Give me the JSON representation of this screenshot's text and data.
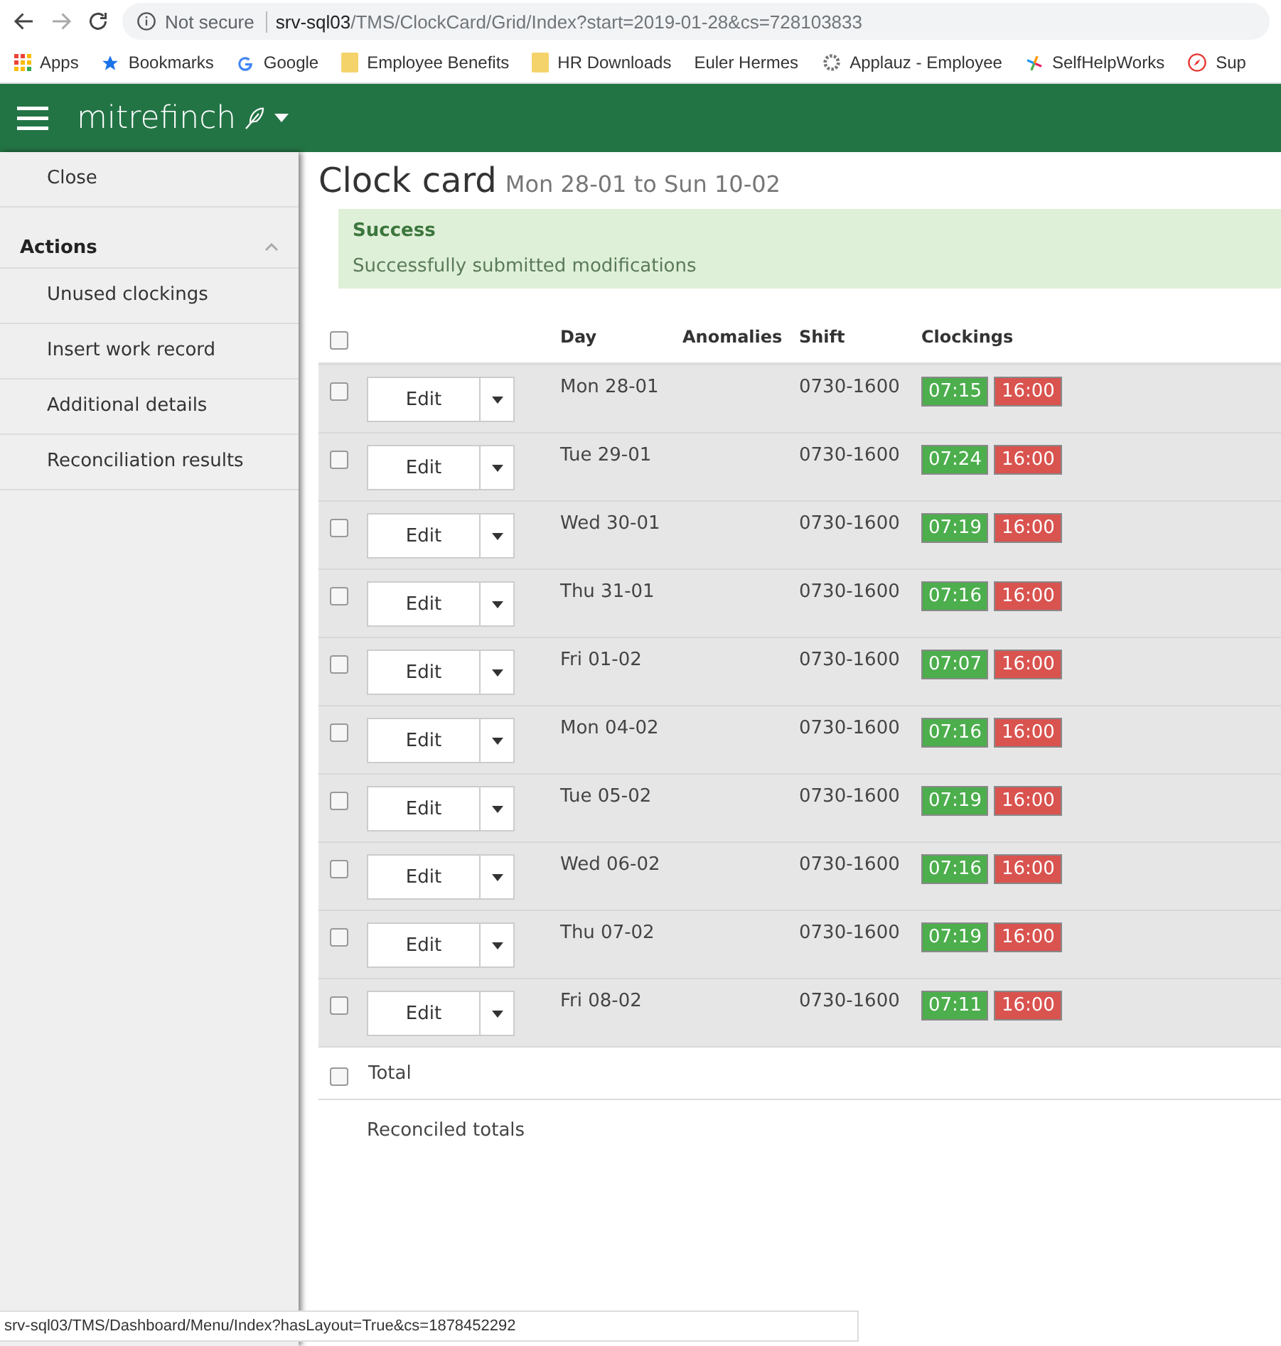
{
  "browser": {
    "security": "Not secure",
    "url_host": "srv-sql03",
    "url_path": "/TMS/ClockCard/Grid/Index?start=2019-01-28&cs=728103833",
    "bookmarks": [
      {
        "label": "Apps",
        "kind": "grid"
      },
      {
        "label": "Bookmarks",
        "kind": "star"
      },
      {
        "label": "Google",
        "kind": "google"
      },
      {
        "label": "Employee Benefits",
        "kind": "folder"
      },
      {
        "label": "HR Downloads",
        "kind": "folder"
      },
      {
        "label": "Euler Hermes",
        "kind": "plain"
      },
      {
        "label": "Applauz - Employee",
        "kind": "gear"
      },
      {
        "label": "SelfHelpWorks",
        "kind": "spark"
      },
      {
        "label": "Sup",
        "kind": "compass"
      }
    ]
  },
  "header": {
    "brand": "mitrefinch"
  },
  "sidebar": {
    "close": "Close",
    "section": {
      "title": "Actions",
      "expanded": true
    },
    "items": [
      "Unused clockings",
      "Insert work record",
      "Additional details",
      "Reconciliation results"
    ]
  },
  "page": {
    "title": "Clock card",
    "subtitle": "Mon 28-01 to Sun 10-02"
  },
  "alert": {
    "title": "Success",
    "message": "Successfully submitted modifications"
  },
  "table": {
    "all_checked": false,
    "columns": [
      "Day",
      "Anomalies",
      "Shift",
      "Clockings"
    ],
    "rows": [
      {
        "checked": false,
        "button": "Edit",
        "day": "Mon 28-01",
        "shift": "0730-1600",
        "clockings": [
          {
            "kind": "in",
            "time": "07:15"
          },
          {
            "kind": "out",
            "time": "16:00"
          }
        ]
      },
      {
        "checked": false,
        "button": "Edit",
        "day": "Tue 29-01",
        "shift": "0730-1600",
        "clockings": [
          {
            "kind": "in",
            "time": "07:24"
          },
          {
            "kind": "out",
            "time": "16:00"
          }
        ]
      },
      {
        "checked": false,
        "button": "Edit",
        "day": "Wed 30-01",
        "shift": "0730-1600",
        "clockings": [
          {
            "kind": "in",
            "time": "07:19"
          },
          {
            "kind": "out",
            "time": "16:00"
          }
        ]
      },
      {
        "checked": false,
        "button": "Edit",
        "day": "Thu 31-01",
        "shift": "0730-1600",
        "clockings": [
          {
            "kind": "in",
            "time": "07:16"
          },
          {
            "kind": "out",
            "time": "16:00"
          }
        ]
      },
      {
        "checked": false,
        "button": "Edit",
        "day": "Fri 01-02",
        "shift": "0730-1600",
        "clockings": [
          {
            "kind": "in",
            "time": "07:07"
          },
          {
            "kind": "out",
            "time": "16:00"
          }
        ]
      },
      {
        "checked": false,
        "button": "Edit",
        "day": "Mon 04-02",
        "shift": "0730-1600",
        "clockings": [
          {
            "kind": "in",
            "time": "07:16"
          },
          {
            "kind": "out",
            "time": "16:00"
          }
        ]
      },
      {
        "checked": false,
        "button": "Edit",
        "day": "Tue 05-02",
        "shift": "0730-1600",
        "clockings": [
          {
            "kind": "in",
            "time": "07:19"
          },
          {
            "kind": "out",
            "time": "16:00"
          }
        ]
      },
      {
        "checked": false,
        "button": "Edit",
        "day": "Wed 06-02",
        "shift": "0730-1600",
        "clockings": [
          {
            "kind": "in",
            "time": "07:16"
          },
          {
            "kind": "out",
            "time": "16:00"
          }
        ]
      },
      {
        "checked": false,
        "button": "Edit",
        "day": "Thu 07-02",
        "shift": "0730-1600",
        "clockings": [
          {
            "kind": "in",
            "time": "07:19"
          },
          {
            "kind": "out",
            "time": "16:00"
          }
        ]
      },
      {
        "checked": false,
        "button": "Edit",
        "day": "Fri 08-02",
        "shift": "0730-1600",
        "clockings": [
          {
            "kind": "in",
            "time": "07:11"
          },
          {
            "kind": "out",
            "time": "16:00"
          }
        ]
      }
    ],
    "total": {
      "checked": false,
      "label": "Total"
    },
    "reconciled": "Reconciled totals"
  },
  "status_bar": "srv-sql03/TMS/Dashboard/Menu/Index?hasLayout=True&cs=1878452292"
}
